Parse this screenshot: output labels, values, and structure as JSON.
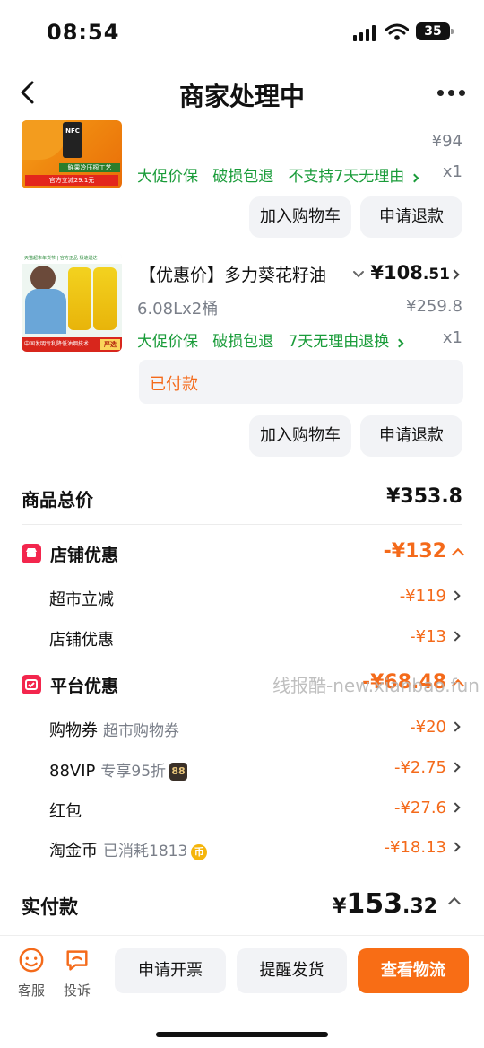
{
  "status": {
    "time": "08:54",
    "battery": "35"
  },
  "nav": {
    "title": "商家处理中"
  },
  "item1": {
    "thumb_caption": "鲜果冷压榨工艺",
    "thumb_badge": "官方立减29.1元",
    "thumb_label": "NFC",
    "price": "¥94",
    "tags": [
      "大促价保",
      "破损包退",
      "不支持7天无理由"
    ],
    "qty": "x1",
    "btn_cart": "加入购物车",
    "btn_refund": "申请退款"
  },
  "item2": {
    "thumb_header": "天猫超市年货节 | 官方正品 极速送达",
    "thumb_footer": "中国发明专利降低油烟技术",
    "thumb_tag": "严选",
    "title": "【优惠价】多力葵花籽油",
    "price_int": "¥108",
    "price_dec": ".51",
    "spec": "6.08Lx2桶",
    "orig_price": "¥259.8",
    "tags": [
      "大促价保",
      "破损包退",
      "7天无理由退换"
    ],
    "qty": "x1",
    "paid_status": "已付款",
    "btn_cart": "加入购物车",
    "btn_refund": "申请退款"
  },
  "summary": {
    "total_label": "商品总价",
    "total_value": "¥353.8"
  },
  "store_discount": {
    "label": "店铺优惠",
    "total": "-¥132",
    "items": [
      {
        "name": "超市立减",
        "sub": "",
        "amount": "-¥119"
      },
      {
        "name": "店铺优惠",
        "sub": "",
        "amount": "-¥13"
      }
    ]
  },
  "platform_discount": {
    "label": "平台优惠",
    "total": "-¥68.48",
    "items": [
      {
        "name": "购物券",
        "sub": "超市购物券",
        "amount": "-¥20"
      },
      {
        "name": "88VIP",
        "sub": "专享95折",
        "badge": "88",
        "amount": "-¥2.75"
      },
      {
        "name": "红包",
        "sub": "",
        "amount": "-¥27.6"
      },
      {
        "name": "淘金币",
        "sub": "已消耗1813",
        "coin": "币",
        "amount": "-¥18.13"
      }
    ]
  },
  "watermark": "线报酷-new.xianbao.fun",
  "actual": {
    "label": "实付款",
    "yen": "¥",
    "int": "153",
    "dec": ".32"
  },
  "bottom": {
    "service": "客服",
    "complain": "投诉",
    "invoice": "申请开票",
    "remind": "提醒发货",
    "logistics": "查看物流"
  },
  "colors": {
    "accent": "#f46a1a",
    "green": "#1a9c3a",
    "red_icon": "#f3264d"
  }
}
